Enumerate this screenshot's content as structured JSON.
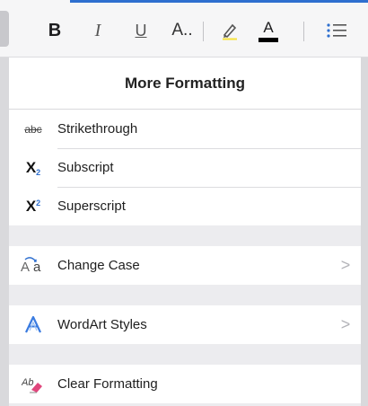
{
  "toolbar": {
    "bold_label": "B",
    "italic_label": "I",
    "underline_label": "U",
    "font_format_label": "A..",
    "font_color_label": "A",
    "accent_color": "#2e6fcf"
  },
  "panel": {
    "title": "More Formatting",
    "groups": [
      {
        "items": [
          {
            "icon": "strikethrough-icon",
            "icon_text": "abc",
            "label": "Strikethrough"
          },
          {
            "icon": "subscript-icon",
            "icon_text": "X",
            "icon_sub": "2",
            "label": "Subscript"
          },
          {
            "icon": "superscript-icon",
            "icon_text": "X",
            "icon_sup": "2",
            "label": "Superscript"
          }
        ]
      },
      {
        "items": [
          {
            "icon": "change-case-icon",
            "label": "Change Case",
            "chevron": ">"
          }
        ]
      },
      {
        "items": [
          {
            "icon": "wordart-icon",
            "label": "WordArt Styles",
            "chevron": ">"
          }
        ]
      },
      {
        "items": [
          {
            "icon": "clear-formatting-icon",
            "label": "Clear Formatting"
          }
        ]
      }
    ]
  }
}
